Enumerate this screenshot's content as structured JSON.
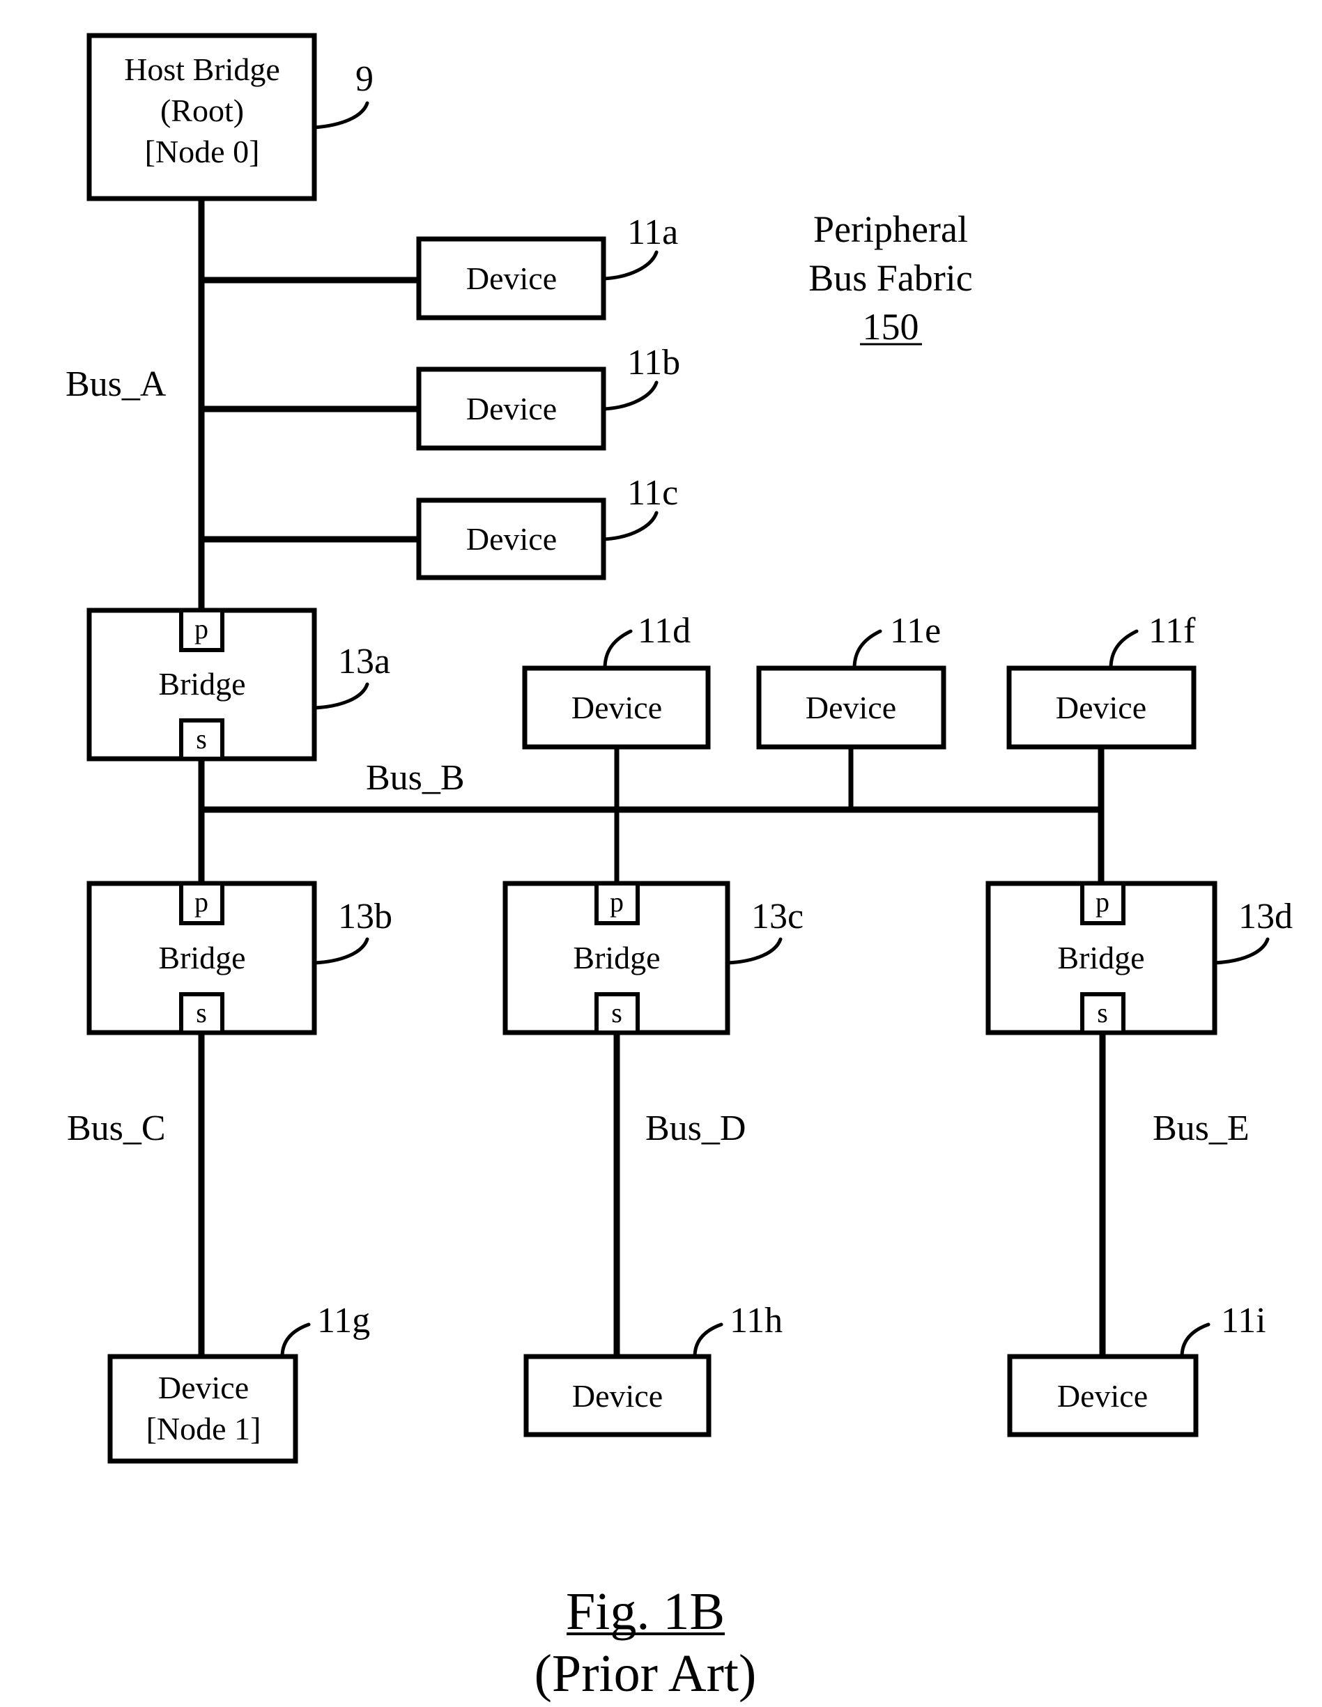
{
  "figure": {
    "caption": "Fig. 1B",
    "subcaption": "(Prior Art)",
    "title_line1": "Peripheral",
    "title_line2": "Bus Fabric",
    "title_ref": "150",
    "stroke_color": "#000000",
    "background_color": "#ffffff"
  },
  "host_bridge": {
    "line1": "Host Bridge",
    "line2": "(Root)",
    "line3": "[Node 0]",
    "ref": "9"
  },
  "buses": {
    "a": "Bus_A",
    "b": "Bus_B",
    "c": "Bus_C",
    "d": "Bus_D",
    "e": "Bus_E"
  },
  "bridges": [
    {
      "label": "Bridge",
      "ref": "13a",
      "primary_port": "p",
      "secondary_port": "s"
    },
    {
      "label": "Bridge",
      "ref": "13b",
      "primary_port": "p",
      "secondary_port": "s"
    },
    {
      "label": "Bridge",
      "ref": "13c",
      "primary_port": "p",
      "secondary_port": "s"
    },
    {
      "label": "Bridge",
      "ref": "13d",
      "primary_port": "p",
      "secondary_port": "s"
    }
  ],
  "devices": [
    {
      "label": "Device",
      "ref": "11a"
    },
    {
      "label": "Device",
      "ref": "11b"
    },
    {
      "label": "Device",
      "ref": "11c"
    },
    {
      "label": "Device",
      "ref": "11d"
    },
    {
      "label": "Device",
      "ref": "11e"
    },
    {
      "label": "Device",
      "ref": "11f"
    },
    {
      "label": "Device",
      "label2": "[Node 1]",
      "ref": "11g"
    },
    {
      "label": "Device",
      "ref": "11h"
    },
    {
      "label": "Device",
      "ref": "11i"
    }
  ]
}
